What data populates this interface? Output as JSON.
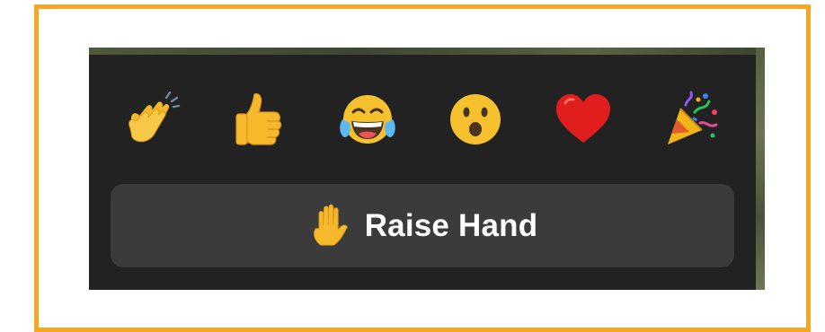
{
  "frame": {
    "border_color": "#f5a623"
  },
  "panel": {
    "background": "#222222"
  },
  "reactions": [
    {
      "name": "clapping-hands",
      "icon": "clap-icon"
    },
    {
      "name": "thumbs-up",
      "icon": "thumbs-up-icon"
    },
    {
      "name": "tears-of-joy",
      "icon": "tears-of-joy-icon"
    },
    {
      "name": "open-mouth",
      "icon": "surprised-face-icon"
    },
    {
      "name": "heart",
      "icon": "red-heart-icon"
    },
    {
      "name": "party-popper",
      "icon": "party-popper-icon"
    }
  ],
  "raise_hand": {
    "label": "Raise Hand",
    "icon": "raised-hand-icon",
    "background": "#3b3b3b"
  }
}
